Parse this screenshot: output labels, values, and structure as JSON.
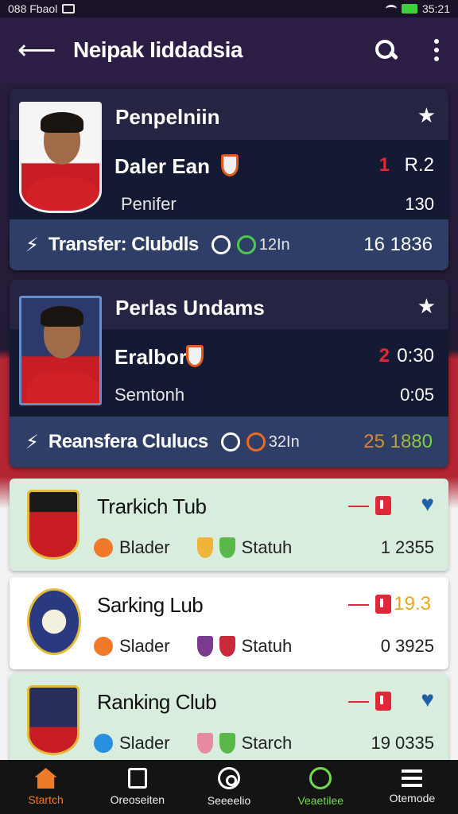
{
  "status_bar": {
    "left_text": "088 Fbaol",
    "right_text": "35:21"
  },
  "app_bar": {
    "title": "Neipak Iiddadsia"
  },
  "players": [
    {
      "name": "Penpelniin",
      "club": "Daler Ean",
      "rank": "1",
      "stat_a": "R.2",
      "position": "Penifer",
      "stat_b": "130",
      "transfer_label": "Transfer: Clubdls",
      "transfer_small": "12In",
      "transfer_value": "16 1836"
    },
    {
      "name": "Perlas Undams",
      "club": "Eralbor",
      "rank": "2",
      "stat_a": "0:30",
      "position": "Semtonh",
      "stat_b": "0:05",
      "transfer_label": "Reansfera Clulucs",
      "transfer_small": "32In",
      "transfer_value": "25 1880"
    }
  ],
  "clubs": [
    {
      "name": "Trarkich Tub",
      "stat1": "Blader",
      "stat2": "Statuh",
      "value": "1  2355",
      "right_mark": "♥"
    },
    {
      "name": "Sarking Lub",
      "stat1": "Slader",
      "stat2": "Statuh",
      "value": "0  3925",
      "right_mark": "19.3"
    },
    {
      "name": "Ranking Club",
      "stat1": "Slader",
      "stat2": "Starch",
      "value": "19  0335",
      "right_mark": "♥"
    }
  ],
  "nav": [
    {
      "label": "Startch"
    },
    {
      "label": "Oreoseiten"
    },
    {
      "label": "Seeeelio"
    },
    {
      "label": "Veaetilee"
    },
    {
      "label": "Otemode"
    }
  ],
  "colors": {
    "accent_orange": "#f07a2a",
    "accent_red": "#e0283a",
    "accent_green": "#6fdc4a"
  }
}
